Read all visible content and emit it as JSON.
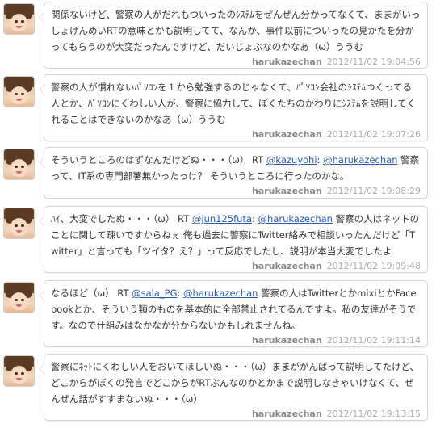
{
  "tweets": [
    {
      "segments": [
        {
          "t": "関係ないけど、警察の人がだれもついったのｼｽﾃﾑをぜんぜん分かってなくて、ままがいっしょけんめいRTの意味とかも説明してて、なんか、事件以前についったの見かたを分かってもらうのが大変だったんですけど、だいじょぶなのかなあ（ω）ううむ"
        }
      ],
      "user": "harukazechan",
      "time": "2012/11/02 19:04:56"
    },
    {
      "segments": [
        {
          "t": "警察の人が慣れないﾊﾟｿｺﾝを１から勉強するのじゃなくて、ﾊﾟｿｺﾝ会社のｼｽﾃﾑつくってる人とか、ﾊﾟｿｺﾝにくわしい人が、警察に協力して、ぼくたちのかわりにｼｽﾃﾑを説明してくれることはできないのかなあ（ω）ううむ"
        }
      ],
      "user": "harukazechan",
      "time": "2012/11/02 19:07:26"
    },
    {
      "segments": [
        {
          "t": "そういうところのはずなんだけどぬ・・・（ω） RT "
        },
        {
          "t": "@kazuyohi",
          "link": true
        },
        {
          "t": ": "
        },
        {
          "t": "@harukazechan",
          "link": true
        },
        {
          "t": " 警察って、IT系の専門部署無かったっけ？ そういうところに行ったのかな。"
        }
      ],
      "user": "harukazechan",
      "time": "2012/11/02 19:08:29"
    },
    {
      "segments": [
        {
          "t": "ﾊｲ、大変でしたぬ・・・（ω） RT "
        },
        {
          "t": "@jun125futa",
          "link": true
        },
        {
          "t": ": "
        },
        {
          "t": "@harukazechan",
          "link": true
        },
        {
          "t": " 警察の人はネットのことに関して疎いですからねぇ 俺も過去に警察にTwitter絡みで相談いったんだけど「Twitter」と言っても「ツイタ？え？」って反応でしたし、説明が本当大変でしたよ"
        }
      ],
      "user": "harukazechan",
      "time": "2012/11/02 19:09:48"
    },
    {
      "segments": [
        {
          "t": "なるほど（ω） RT "
        },
        {
          "t": "@sala_PG",
          "link": true
        },
        {
          "t": ": "
        },
        {
          "t": "@harukazechan",
          "link": true
        },
        {
          "t": " 警察の人はTwitterとかmixiとかFacebookとか、そういう類のものを基本的に全部禁止されてるんですよ。私の友達がそうです。なので仕組みはなかなか分からないかもしれませんね。"
        }
      ],
      "user": "harukazechan",
      "time": "2012/11/02 19:11:14"
    },
    {
      "segments": [
        {
          "t": "警察にﾈｯﾄにくわしい人をおいてほしいぬ・・・（ω）ままががんばって説明してたけど、どこからがぼくの発言でどこからがRTぶんなのかとかまで説明しなきゃいけなくて、ぜんぜん話がすすまないぬ・・・（ω）"
        }
      ],
      "user": "harukazechan",
      "time": "2012/11/02 19:13:15"
    }
  ]
}
